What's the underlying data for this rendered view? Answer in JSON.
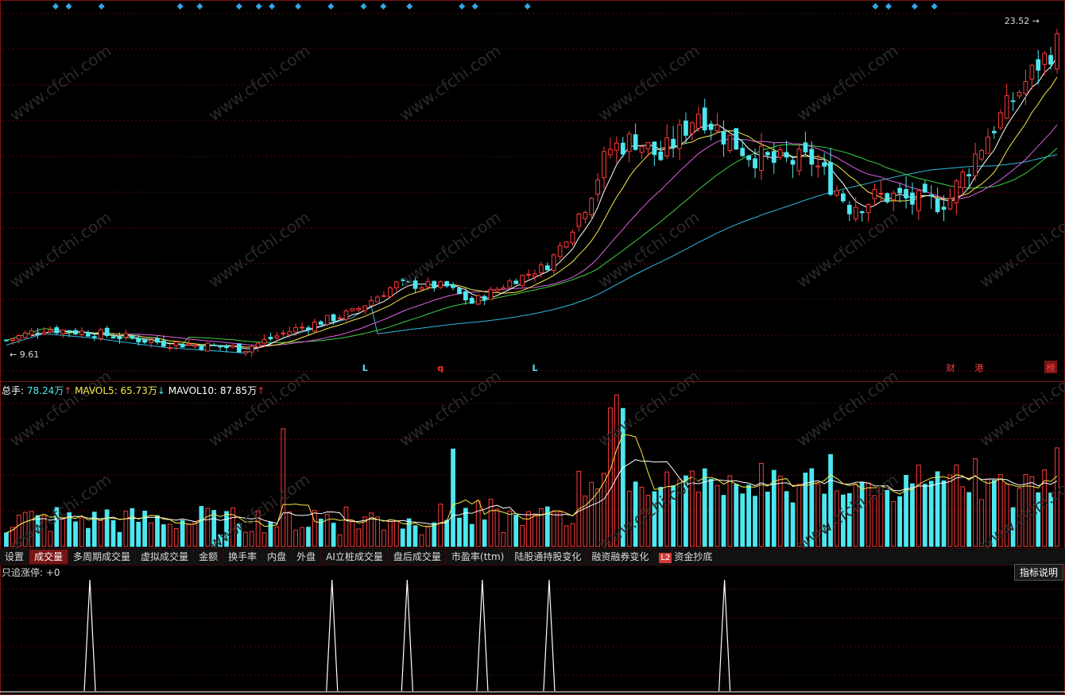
{
  "price_panel": {
    "high_label": "23.52",
    "low_label": "9.61",
    "markers": [
      {
        "text": "L",
        "color": "#4ce7f0",
        "index": 57
      },
      {
        "text": "q",
        "color": "#ff3030",
        "index": 69
      },
      {
        "text": "L",
        "color": "#4ce7f0",
        "index": 84
      }
    ],
    "badges": [
      {
        "text": "财",
        "color": "#ff4040"
      },
      {
        "text": "港",
        "color": "#ff4040"
      },
      {
        "text": "榜",
        "color": "#ff4040"
      }
    ]
  },
  "volume_panel": {
    "legend": [
      {
        "label": "总手",
        "value": "78.24万",
        "arrow": "↑",
        "color": "#4ce7f0"
      },
      {
        "label": "MAVOL5",
        "value": "65.73万",
        "arrow": "↓",
        "color": "#f5e94a"
      },
      {
        "label": "MAVOL10",
        "value": "87.85万",
        "arrow": "↑",
        "color": "#ffffff"
      }
    ]
  },
  "tabs": [
    {
      "label": "设置"
    },
    {
      "label": "成交量",
      "active": true
    },
    {
      "label": "多周期成交量"
    },
    {
      "label": "虚拟成交量"
    },
    {
      "label": "金额"
    },
    {
      "label": "换手率"
    },
    {
      "label": "内盘"
    },
    {
      "label": "外盘"
    },
    {
      "label": "AI立桩成交量"
    },
    {
      "label": "盘后成交量"
    },
    {
      "label": "市盈率(ttm)"
    },
    {
      "label": "陆股通持股变化"
    },
    {
      "label": "融资融券变化"
    },
    {
      "label": "资金抄底",
      "badge": "L2"
    }
  ],
  "indicator_panel": {
    "title": "只追涨停: +0",
    "help_label": "指标说明",
    "spike_positions": [
      10,
      39,
      48,
      57,
      65,
      86
    ]
  },
  "watermark": "www.cfchi.com",
  "colors": {
    "up": "#ff3b3b",
    "down": "#4ce7f0",
    "grid": "#5a0d0d",
    "ma5": "#ffffff",
    "ma10": "#f5e94a",
    "ma20": "#e060e0",
    "ma30": "#40d040",
    "ma60": "#30b8e0"
  },
  "chart_data": {
    "type": "candlestick",
    "ylim": [
      9.61,
      23.52
    ],
    "count": 168,
    "series_note": "",
    "candles_key": ""
  }
}
